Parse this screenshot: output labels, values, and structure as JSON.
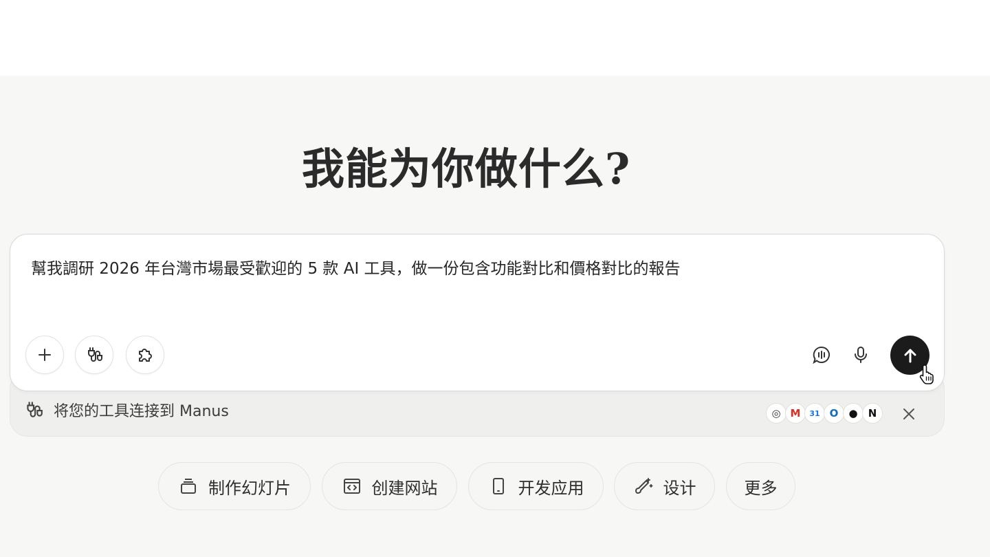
{
  "heading": "我能为你做什么?",
  "composer": {
    "prompt_text": "幫我調研 2026 年台灣市場最受歡迎的 5 款 AI 工具，做一份包含功能對比和價格對比的報告",
    "left_tools": [
      {
        "icon": "plus-icon"
      },
      {
        "icon": "connector-icon"
      },
      {
        "icon": "puzzle-icon"
      }
    ],
    "right_tools": [
      {
        "icon": "voice-chat-icon"
      },
      {
        "icon": "microphone-icon"
      },
      {
        "icon": "arrow-up-icon"
      }
    ]
  },
  "connect_tray": {
    "label": "将您的工具连接到 Manus",
    "apps": [
      {
        "name": "chrome-icon",
        "glyph": "◎",
        "color": "#333333"
      },
      {
        "name": "gmail-icon",
        "glyph": "M",
        "color": "#d93025"
      },
      {
        "name": "calendar-icon",
        "glyph": "31",
        "color": "#1a73e8"
      },
      {
        "name": "outlook-icon",
        "glyph": "O",
        "color": "#0f6cbd"
      },
      {
        "name": "github-icon",
        "glyph": "●",
        "color": "#111111"
      },
      {
        "name": "notion-icon",
        "glyph": "N",
        "color": "#111111"
      }
    ]
  },
  "quick_actions": [
    {
      "label": "制作幻灯片",
      "icon": "slides-icon"
    },
    {
      "label": "创建网站",
      "icon": "website-icon"
    },
    {
      "label": "开发应用",
      "icon": "mobile-app-icon"
    },
    {
      "label": "设计",
      "icon": "design-icon"
    },
    {
      "label": "更多",
      "icon": ""
    }
  ]
}
